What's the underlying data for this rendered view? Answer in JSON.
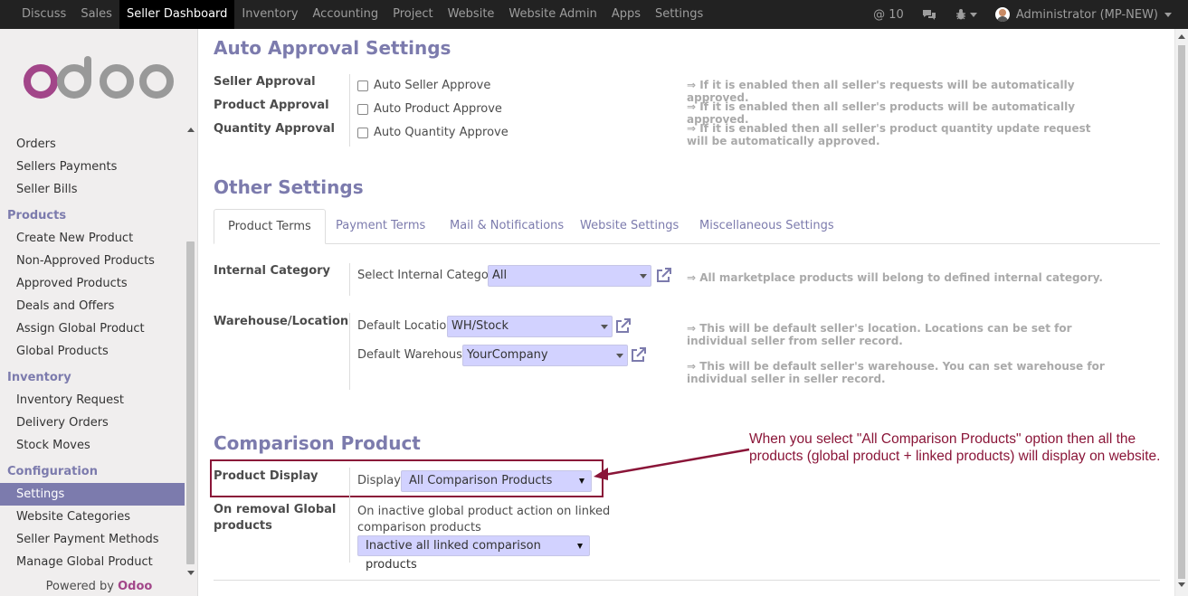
{
  "topbar": {
    "menu": [
      "Discuss",
      "Sales",
      "Seller Dashboard",
      "Inventory",
      "Accounting",
      "Project",
      "Website",
      "Website Admin",
      "Apps",
      "Settings"
    ],
    "active_menu": "Seller Dashboard",
    "mentions_count": "@ 10",
    "user": "Administrator (MP-NEW)"
  },
  "sidebar": {
    "logo_text": "odoo",
    "items_top": [
      "Orders",
      "Sellers Payments",
      "Seller Bills"
    ],
    "products_title": "Products",
    "products_items": [
      "Create New Product",
      "Non-Approved Products",
      "Approved Products",
      "Deals and Offers",
      "Assign Global Product",
      "Global Products"
    ],
    "inventory_title": "Inventory",
    "inventory_items": [
      "Inventory Request",
      "Delivery Orders",
      "Stock Moves"
    ],
    "configuration_title": "Configuration",
    "configuration_items": [
      "Settings",
      "Website Categories",
      "Seller Payment Methods",
      "Manage Global Product"
    ],
    "active_item": "Settings",
    "powered_prefix": "Powered by",
    "powered_brand": "Odoo"
  },
  "auto_approval": {
    "title": "Auto Approval Settings",
    "rows": [
      {
        "label": "Seller Approval",
        "checkbox": "Auto Seller Approve",
        "checked": false,
        "help": "⇒ If it is enabled then all seller's requests will be automatically approved."
      },
      {
        "label": "Product Approval",
        "checkbox": "Auto Product Approve",
        "checked": false,
        "help": "⇒ If it is enabled then all seller's products will be automatically approved."
      },
      {
        "label": "Quantity Approval",
        "checkbox": "Auto Quantity Approve",
        "checked": false,
        "help": "⇒ If it is enabled then all seller's product quantity update request will be automatically approved."
      }
    ]
  },
  "other_settings": {
    "title": "Other Settings",
    "tabs": [
      "Product Terms",
      "Payment Terms",
      "Mail & Notifications",
      "Website Settings",
      "Miscellaneous Settings"
    ],
    "active_tab": "Product Terms",
    "internal_category": {
      "label": "Internal Category",
      "field_label": "Select Internal Category",
      "value": "All",
      "help": "⇒ All marketplace products will belong to defined internal category."
    },
    "warehouse": {
      "label": "Warehouse/Location",
      "location_label": "Default Location",
      "location_value": "WH/Stock",
      "location_help": "⇒ This will be default seller's location. Locations can be set for individual seller from seller record.",
      "warehouse_label": "Default Warehouse",
      "warehouse_value": "YourCompany",
      "warehouse_help": "⇒ This will be default seller's warehouse. You can set warehouse for individual seller in seller record."
    }
  },
  "comparison": {
    "title": "Comparison Product",
    "display_label": "Product Display",
    "display_field_label": "Display",
    "display_value": "All Comparison Products",
    "removal_label": "On removal Global products",
    "removal_text": "On inactive global product action on linked comparison products",
    "removal_value": "Inactive all linked comparison products",
    "annotation": "When you select \"All Comparison Products\" option then all the products (global product + linked products) will display on website."
  },
  "colors": {
    "accent": "#7c7bad",
    "annotation": "#8a1538",
    "select_bg": "#d2d2ff"
  }
}
